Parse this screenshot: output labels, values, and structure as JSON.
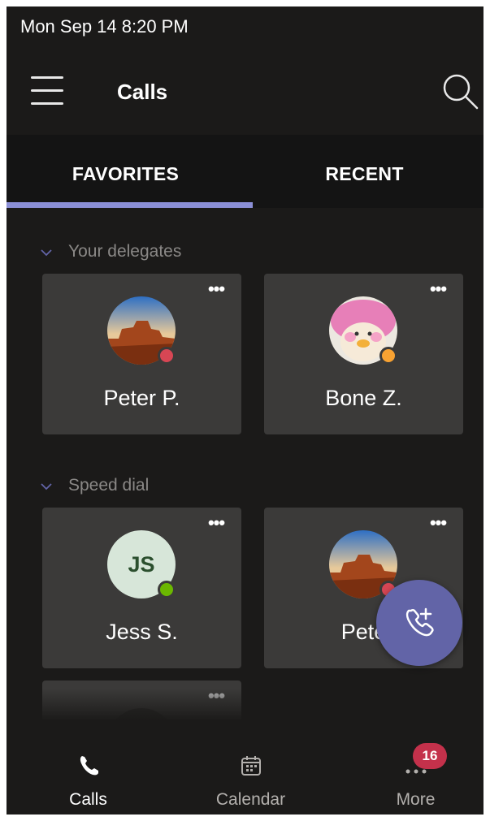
{
  "status_bar": {
    "datetime": "Mon Sep 14  8:20 PM"
  },
  "app_bar": {
    "title": "Calls",
    "menu_icon": "hamburger-menu-icon",
    "search_icon": "search-icon"
  },
  "tabs": [
    {
      "label": "FAVORITES",
      "selected": true
    },
    {
      "label": "RECENT",
      "selected": false
    }
  ],
  "sections": [
    {
      "label": "Your delegates",
      "contacts": [
        {
          "name": "Peter P.",
          "avatar": "desert-landscape-photo",
          "presence": "busy",
          "presence_color": "#d74654"
        },
        {
          "name": "Bone Z.",
          "avatar": "pink-plush-toy-photo",
          "presence": "away",
          "presence_color": "#f8a232"
        }
      ]
    },
    {
      "label": "Speed dial",
      "contacts": [
        {
          "name": "Jess S.",
          "initials": "JS",
          "presence": "available",
          "presence_color": "#6bb700"
        },
        {
          "name": "Pete",
          "avatar": "desert-landscape-photo",
          "presence": "busy",
          "presence_color": "#d74654"
        }
      ]
    }
  ],
  "fab": {
    "icon": "add-call-icon",
    "color": "#6264a7"
  },
  "bottom_nav": [
    {
      "label": "Calls",
      "icon": "phone-icon",
      "active": true
    },
    {
      "label": "Calendar",
      "icon": "calendar-icon",
      "active": false
    },
    {
      "label": "More",
      "icon": "more-dots-icon",
      "active": false,
      "badge": "16"
    }
  ],
  "colors": {
    "background": "#1b1a19",
    "card": "#3b3a39",
    "accent": "#8b8fd6",
    "badge": "#c4314b"
  }
}
